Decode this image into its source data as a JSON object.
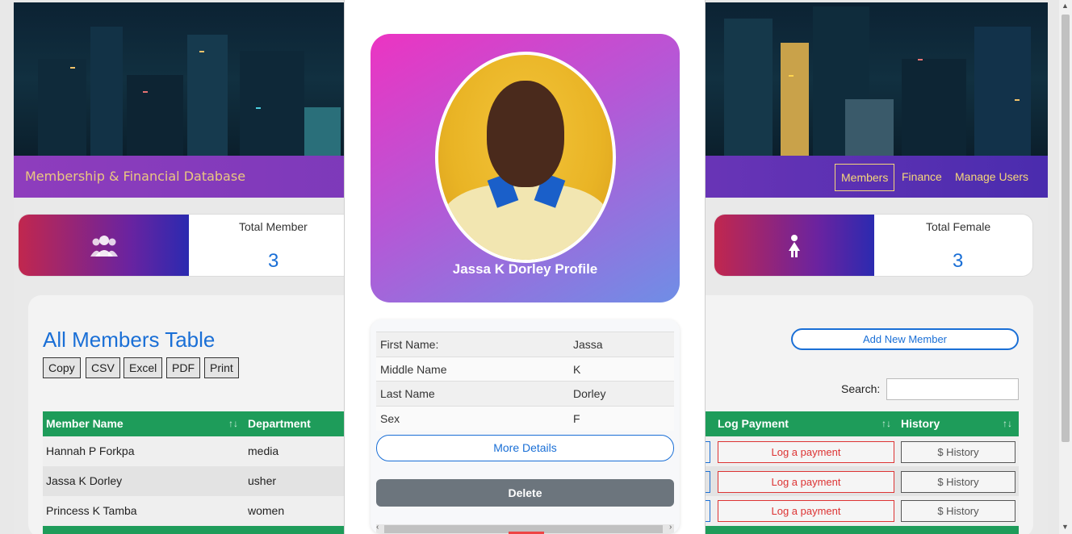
{
  "app": {
    "brand": "Membership & Financial Database",
    "nav": [
      "Members",
      "Finance",
      "Manage Users"
    ]
  },
  "stats": {
    "total_member_label": "Total Member",
    "total_member_value": "3",
    "total_female_label": "Total Female",
    "total_female_value": "3"
  },
  "table": {
    "title": "All Members Table",
    "export_buttons": [
      "Copy",
      "CSV",
      "Excel",
      "PDF",
      "Print"
    ],
    "add_button": "Add New Member",
    "search_label": "Search:",
    "search_value": "",
    "columns": [
      "Member Name",
      "Department",
      "Log Payment",
      "History"
    ],
    "rows": [
      {
        "name": "Hannah P Forkpa",
        "department": "media",
        "log": "Log a payment",
        "history": "$ History"
      },
      {
        "name": "Jassa K Dorley",
        "department": "usher",
        "log": "Log a payment",
        "history": "$ History"
      },
      {
        "name": "Princess K Tamba",
        "department": "women",
        "log": "Log a payment",
        "history": "$ History"
      }
    ]
  },
  "modal": {
    "profile_title": "Jassa K Dorley Profile",
    "details": [
      {
        "label": "First Name:",
        "value": "Jassa"
      },
      {
        "label": "Middle Name",
        "value": "K"
      },
      {
        "label": "Last Name",
        "value": "Dorley"
      },
      {
        "label": "Sex",
        "value": "F"
      }
    ],
    "more_button": "More Details",
    "delete_button": "Delete"
  },
  "icons": {
    "members_stat": "users-group-icon",
    "female_stat": "female-icon",
    "sort": "sort-icon"
  },
  "colors": {
    "accent_blue": "#1a6fd6",
    "table_header": "#1e9c5a",
    "nav_gold": "#f5d77a",
    "danger": "#d33",
    "delete_gray": "#6c757d"
  }
}
